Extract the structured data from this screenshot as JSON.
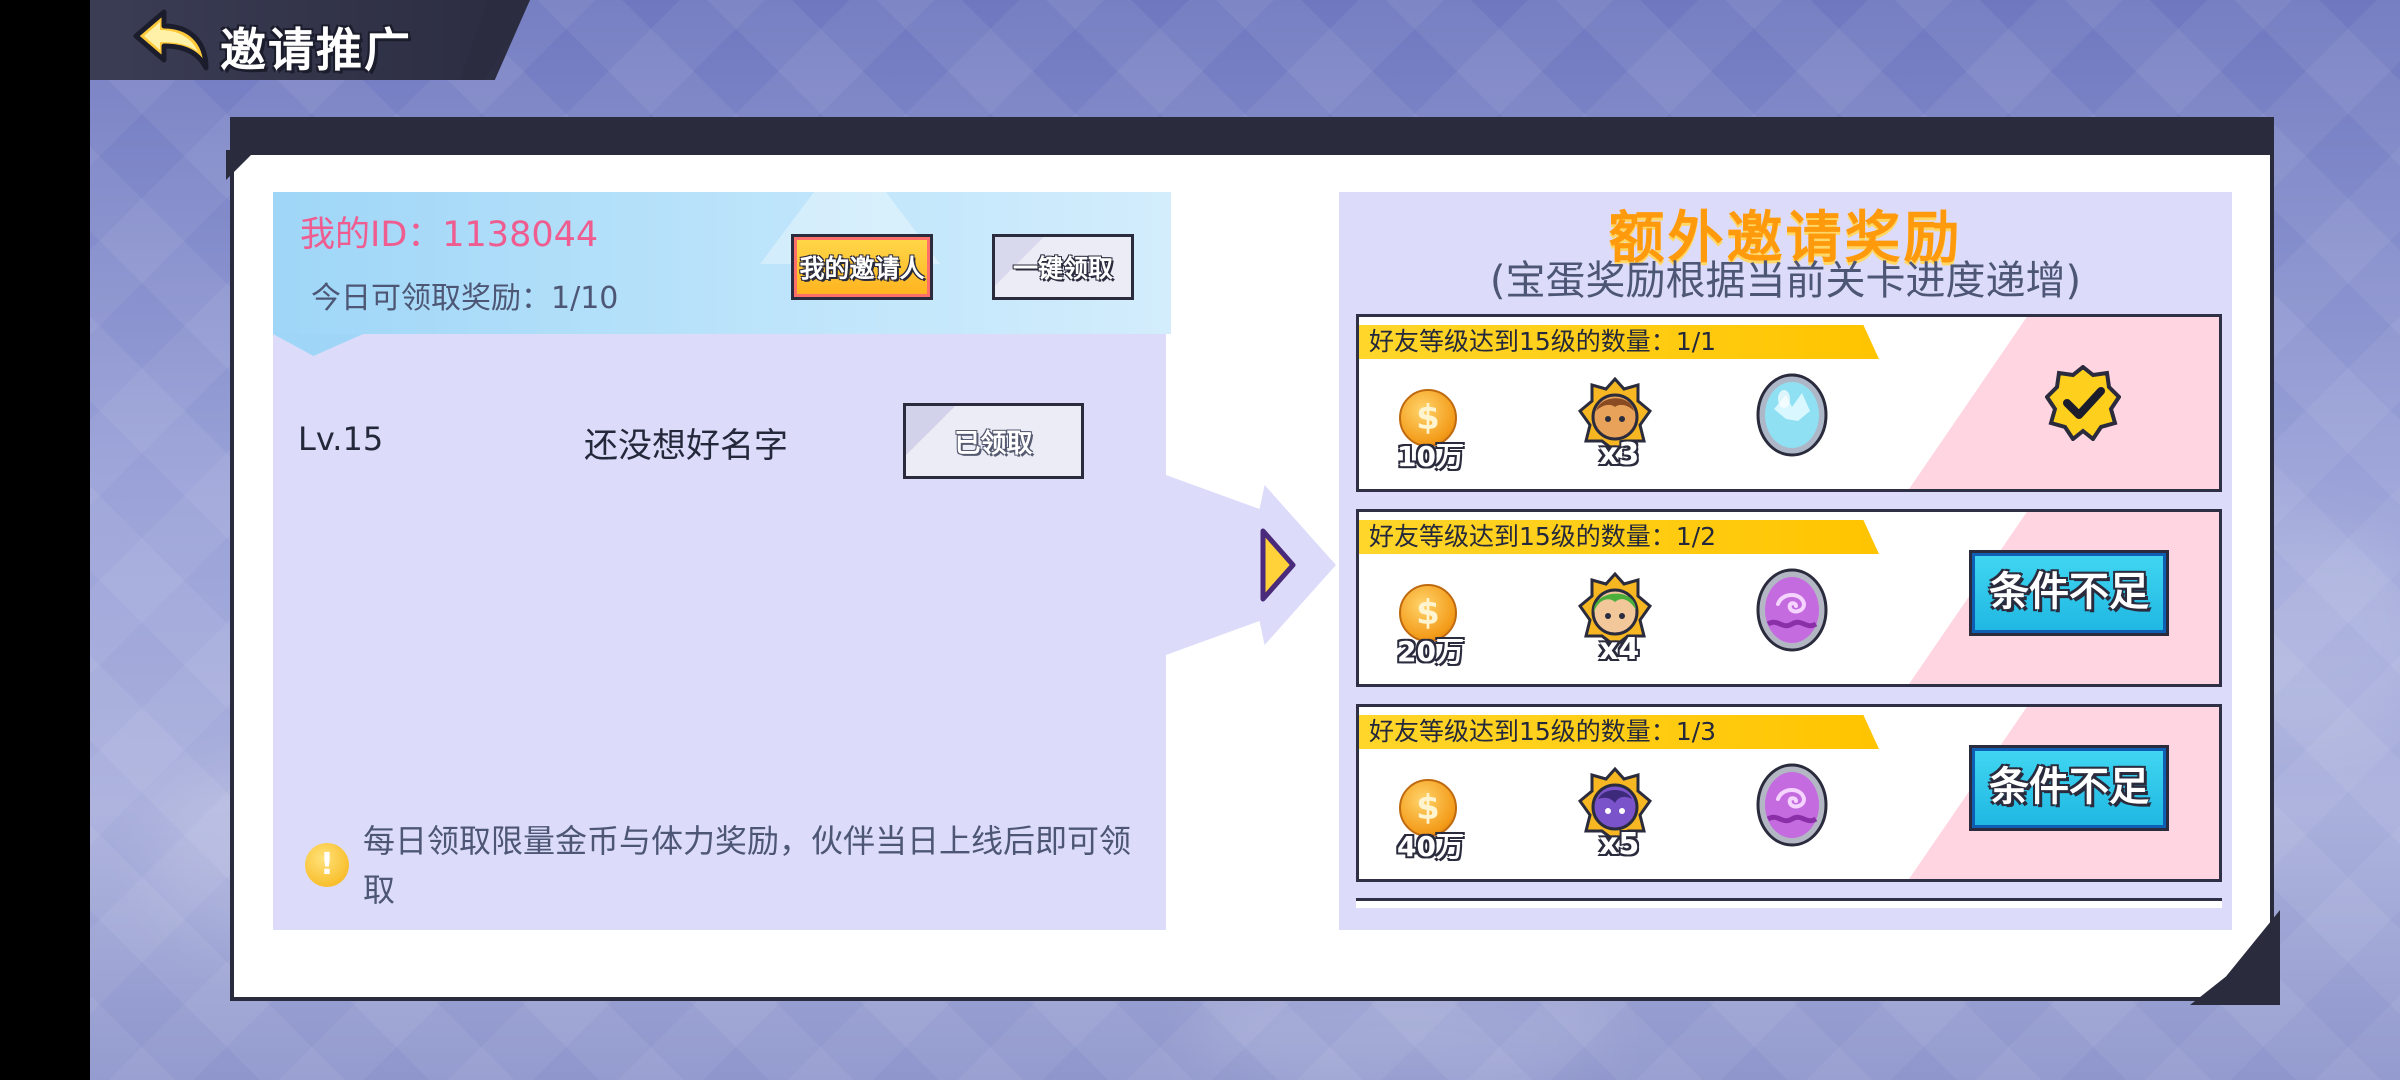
{
  "header": {
    "title": "邀请推广"
  },
  "invite": {
    "my_id": "我的ID：1138044",
    "today_reward": "今日可领取奖励：1/10",
    "inviter_button": "我的邀请人",
    "claim_all_button": "一键领取"
  },
  "friend": {
    "level": "Lv.15",
    "name": "还没想好名字",
    "claimed_button": "已领取"
  },
  "tip": {
    "text": "每日领取限量金币与体力奖励，伙伴当日上线后即可领取"
  },
  "extra_rewards": {
    "title": "额外邀请奖励",
    "subtitle": "(宝蛋奖励根据当前关卡进度递增)",
    "cards": [
      {
        "condition": "好友等级达到15级的数量：1/1",
        "coin_amount": "10万",
        "hero_count": "x3",
        "hero_icon": "hero-brown-icon",
        "egg_icon": "blue-egg-icon",
        "status": "claimed",
        "status_icon": "checkmark-badge-icon"
      },
      {
        "condition": "好友等级达到15级的数量：1/2",
        "coin_amount": "20万",
        "hero_count": "x4",
        "hero_icon": "hero-green-icon",
        "egg_icon": "purple-egg-icon",
        "status": "locked",
        "status_label": "条件不足"
      },
      {
        "condition": "好友等级达到15级的数量：1/3",
        "coin_amount": "40万",
        "hero_count": "x5",
        "hero_icon": "hero-purple-icon",
        "egg_icon": "purple-egg-icon",
        "status": "locked",
        "status_label": "条件不足"
      }
    ]
  },
  "colors": {
    "accent_orange": "#ff9a0d",
    "id_pink": "#ef5c8f",
    "tag_yellow": "#ffc400",
    "button_cyan": "#1fb6e2",
    "panel_lavender": "#dcdcfa"
  }
}
